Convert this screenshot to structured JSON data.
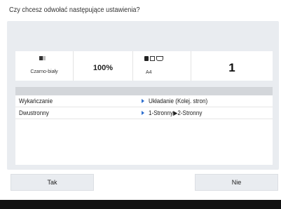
{
  "dialog": {
    "question": "Czy chcesz odwołać następujące ustawienia?"
  },
  "summary": {
    "color_mode_label": "Czarno-biały",
    "color_mode_icon": "black-white-icon",
    "zoom": "100%",
    "paper_icons": "paper-tray-icons",
    "paper_size": "A4",
    "copies": "1"
  },
  "settings": [
    {
      "name": "Wykańczanie",
      "value": "Układanie (Kolej. stron)"
    },
    {
      "name": "Dwustronny",
      "value": "1-Stronny▶2-Stronny"
    }
  ],
  "buttons": {
    "yes": "Tak",
    "no": "Nie"
  },
  "colors": {
    "panel_bg": "#e9ecf0",
    "accent_arrow": "#2e6fcf",
    "bottom_bar": "#121212"
  }
}
